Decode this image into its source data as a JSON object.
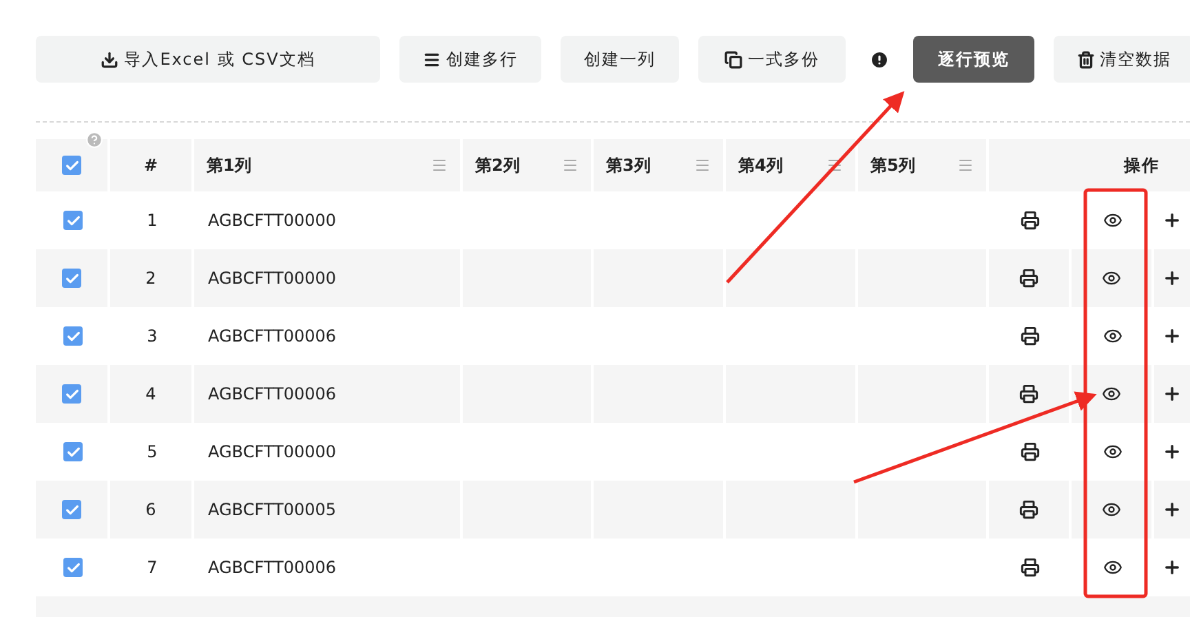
{
  "toolbar": [
    {
      "label": "导入Excel 或 CSV文档",
      "kind": "download",
      "primary": false
    },
    {
      "label": "创建多行",
      "kind": "list",
      "primary": false
    },
    {
      "label": "创建一列",
      "kind": "plain",
      "primary": false
    },
    {
      "label": "一式多份",
      "kind": "copy",
      "primary": false
    },
    {
      "kind": "info"
    },
    {
      "label": "逐行预览",
      "kind": "plain",
      "primary": true
    },
    {
      "label": "清空数据",
      "kind": "trash",
      "primary": false
    }
  ],
  "table": {
    "select_all": {
      "checked": true
    },
    "index_header": "#",
    "columns": [
      "第1列",
      "第2列",
      "第3列",
      "第4列",
      "第5列"
    ],
    "actions_header": "操作",
    "rows": [
      {
        "checked": true,
        "index": "1",
        "cells": [
          "AGBCFTT00000"
        ]
      },
      {
        "checked": true,
        "index": "2",
        "cells": [
          "AGBCFTT00000"
        ]
      },
      {
        "checked": true,
        "index": "3",
        "cells": [
          "AGBCFTT00006"
        ]
      },
      {
        "checked": true,
        "index": "4",
        "cells": [
          "AGBCFTT00006"
        ]
      },
      {
        "checked": true,
        "index": "5",
        "cells": [
          "AGBCFTT00000"
        ]
      },
      {
        "checked": true,
        "index": "6",
        "cells": [
          "AGBCFTT00005"
        ]
      },
      {
        "checked": true,
        "index": "7",
        "cells": [
          "AGBCFTT00006"
        ]
      }
    ]
  }
}
